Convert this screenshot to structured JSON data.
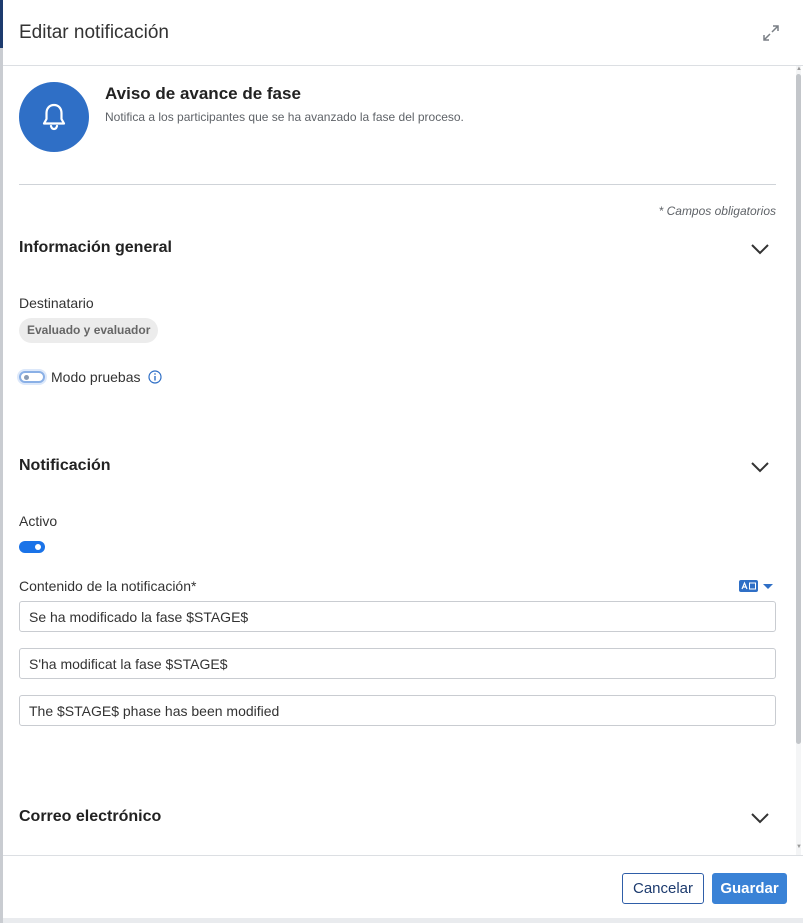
{
  "header": {
    "title": "Editar notificación",
    "expand_icon": "expand-icon"
  },
  "notification": {
    "icon": "bell-icon",
    "title": "Aviso de avance de fase",
    "description": "Notifica a los participantes que se ha avanzado la fase del proceso."
  },
  "required_note": "* Campos obligatorios",
  "general_section": {
    "title": "Información general",
    "recipient_label": "Destinatario",
    "recipient_value": "Evaluado y evaluador",
    "test_mode_label": "Modo pruebas",
    "test_mode_on": false
  },
  "notification_section": {
    "title": "Notificación",
    "active_label": "Activo",
    "active_on": true,
    "content_label": "Contenido de la notificación*",
    "language_icon": "language-select-icon",
    "contents": [
      "Se ha modificado la fase $STAGE$",
      "S'ha modificat la fase $STAGE$",
      "The $STAGE$ phase has been modified"
    ]
  },
  "email_section": {
    "title": "Correo electrónico"
  },
  "footer": {
    "cancel_label": "Cancelar",
    "save_label": "Guardar"
  },
  "colors": {
    "primary": "#2f6fc6",
    "toggle_on": "#1a73e8",
    "save_button": "#3a82d6",
    "navy": "#1d3b6e"
  }
}
